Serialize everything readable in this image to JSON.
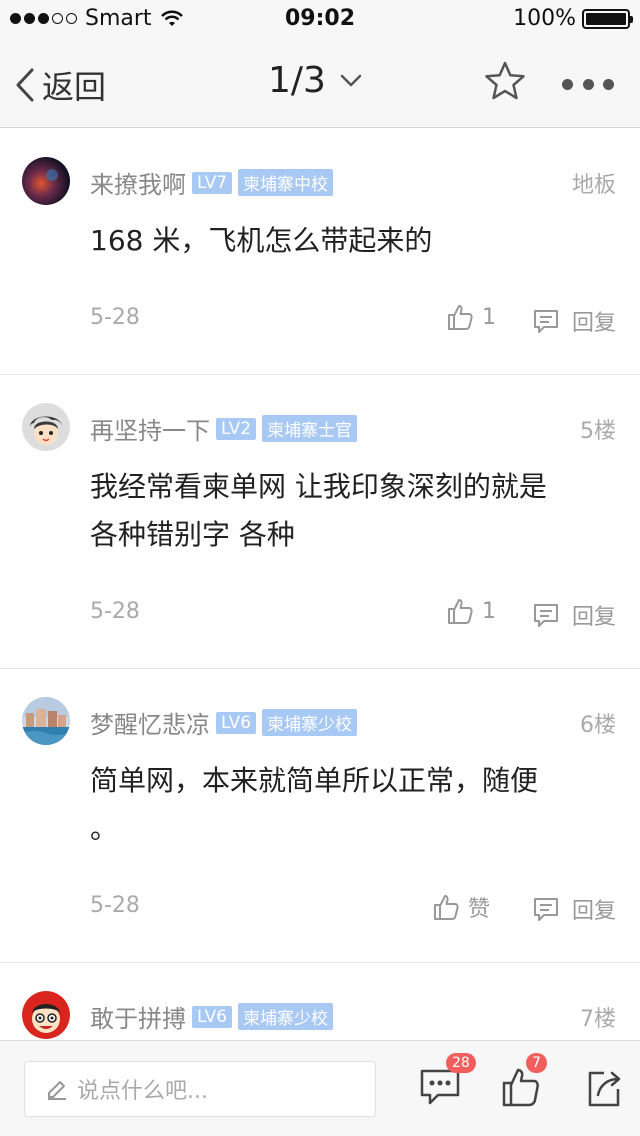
{
  "status_bar": {
    "carrier": "Smart",
    "time": "09:02",
    "battery": "100%",
    "signal_dots_filled": 3,
    "signal_dots_total": 5
  },
  "nav": {
    "back_label": "返回",
    "page_indicator": "1/3"
  },
  "comments": [
    {
      "username": "来撩我啊",
      "level": "LV7",
      "title": "柬埔寨中校",
      "floor": "地板",
      "text_lines": [
        "168 米，飞机怎么带起来的"
      ],
      "date": "5-28",
      "like_label": "1",
      "reply_label": "回复"
    },
    {
      "username": "再坚持一下",
      "level": "LV2",
      "title": "柬埔寨士官",
      "floor": "5楼",
      "text_lines": [
        "我经常看柬单网 让我印象深刻的就是",
        "各种错别字 各种"
      ],
      "date": "5-28",
      "like_label": "1",
      "reply_label": "回复"
    },
    {
      "username": "梦醒忆悲凉",
      "level": "LV6",
      "title": "柬埔寨少校",
      "floor": "6楼",
      "text_lines": [
        "简单网，本来就简单所以正常，随便",
        "。"
      ],
      "date": "5-28",
      "like_label": "赞",
      "reply_label": "回复"
    },
    {
      "username": "敢于拼搏",
      "level": "LV6",
      "title": "柬埔寨少校",
      "floor": "7楼",
      "text_lines": [],
      "date": "",
      "like_label": "",
      "reply_label": ""
    }
  ],
  "bottom_bar": {
    "input_placeholder": "说点什么吧...",
    "comments_badge": "28",
    "likes_badge": "7"
  },
  "colors": {
    "tag_bg": "#a9c9f5",
    "badge": "#f25e5e",
    "muted_text": "#999999"
  }
}
